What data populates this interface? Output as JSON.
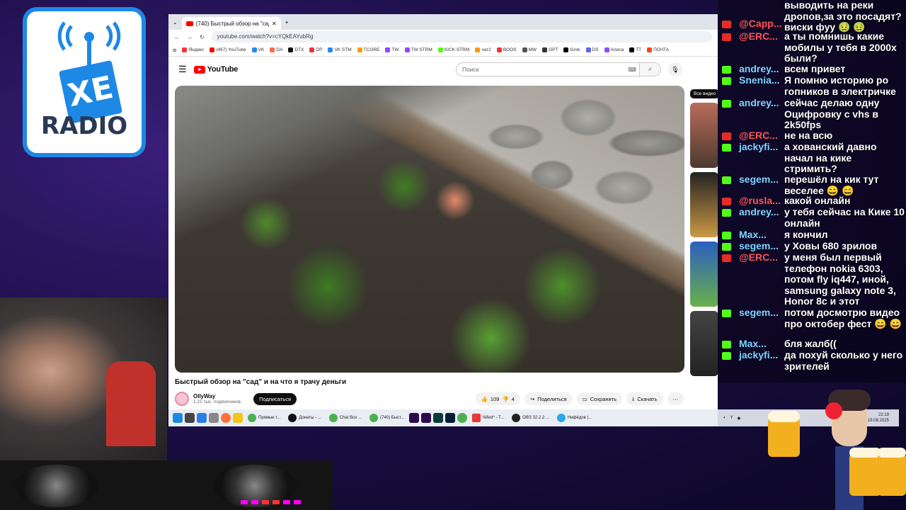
{
  "logo": {
    "text": "RADIO",
    "badge": "XE"
  },
  "browser": {
    "tab_title": "(740) Быстрый обзор на \"сад\"",
    "url": "youtube.com/watch?v=cYQkEAYubRg",
    "bookmarks": [
      "Яндекс",
      "(467) YouTube",
      "VK",
      "DA",
      "DTX",
      "DP",
      "VK STM",
      "TCORE",
      "TW",
      "TW STRM",
      "KICK STRM",
      "чат2",
      "BOOS",
      "MW",
      "GPT",
      "Grok",
      "DS",
      "Алиса",
      "TT",
      "ПОЧТА"
    ]
  },
  "youtube": {
    "logo_text": "YouTube",
    "search_placeholder": "Поиск",
    "video_title": "Быстрый обзор на \"сад\" и на что я трачу деньги",
    "channel_name": "OllyWay",
    "channel_subs": "1,21 тыс. подписчиков",
    "subscribe_label": "Подписаться",
    "likes": "109",
    "dislikes": "4",
    "share_label": "Поделиться",
    "save_label": "Сохранить",
    "download_label": "Скачать",
    "sidebar_chip": "Все видео"
  },
  "taskbar": {
    "apps": [
      "Прямые т...",
      "Донаты - ...",
      "Chat Box ...",
      "(740) Быст...",
      "Nifed^ - T...",
      "OBS 32.2.2 ...",
      "Нифёдов |..."
    ],
    "clock": "22:19",
    "date": "19.08.2025"
  },
  "chat": [
    {
      "platform": "yt",
      "name": "@Сарр...",
      "text": "выводить на реки дропов,за это посадят? виски фуу 🤢 🤢"
    },
    {
      "platform": "yt",
      "name": "@ERC...",
      "text": "а ты помнишь какие мобилы у тебя в 2000х были?"
    },
    {
      "platform": "kick",
      "name": "andrey...",
      "text": "всем привет"
    },
    {
      "platform": "kick",
      "name": "Snenia...",
      "text": "Я помню историю ро гопников в электричке"
    },
    {
      "platform": "kick",
      "name": "andrey...",
      "text": "сейчас делаю одну Оцифровку с vhs в 2k50fps"
    },
    {
      "platform": "yt",
      "name": "@ERC...",
      "text": "не на всю"
    },
    {
      "platform": "kick",
      "name": "jackyfi...",
      "text": "а хованский давно начал на кике стримить?"
    },
    {
      "platform": "kick",
      "name": "segem...",
      "text": "перешёл на кик тут веселее 😄 😄"
    },
    {
      "platform": "yt",
      "name": "@rusla...",
      "text": "какой онлайн"
    },
    {
      "platform": "kick",
      "name": "andrey...",
      "text": "у тебя сейчас на Кике 10 онлайн"
    },
    {
      "platform": "kick",
      "name": "Max...",
      "text": "я кончил"
    },
    {
      "platform": "kick",
      "name": "segem...",
      "text": "у Ховы 680 зрилов"
    },
    {
      "platform": "yt",
      "name": "@ERC...",
      "text": "у меня был первый телефон nokia 6303, потом fly iq447, иной, samsung galaxy note 3, Honor 8c и этот"
    },
    {
      "platform": "kick",
      "name": "segem...",
      "text": "потом досмотрю видео про октобер фест 😄 😄"
    },
    {
      "platform": "kick",
      "name": "Max...",
      "text": "бля жалб(("
    },
    {
      "platform": "kick",
      "name": "jackyfi...",
      "text": "да похуй сколько у него зрителей"
    }
  ]
}
